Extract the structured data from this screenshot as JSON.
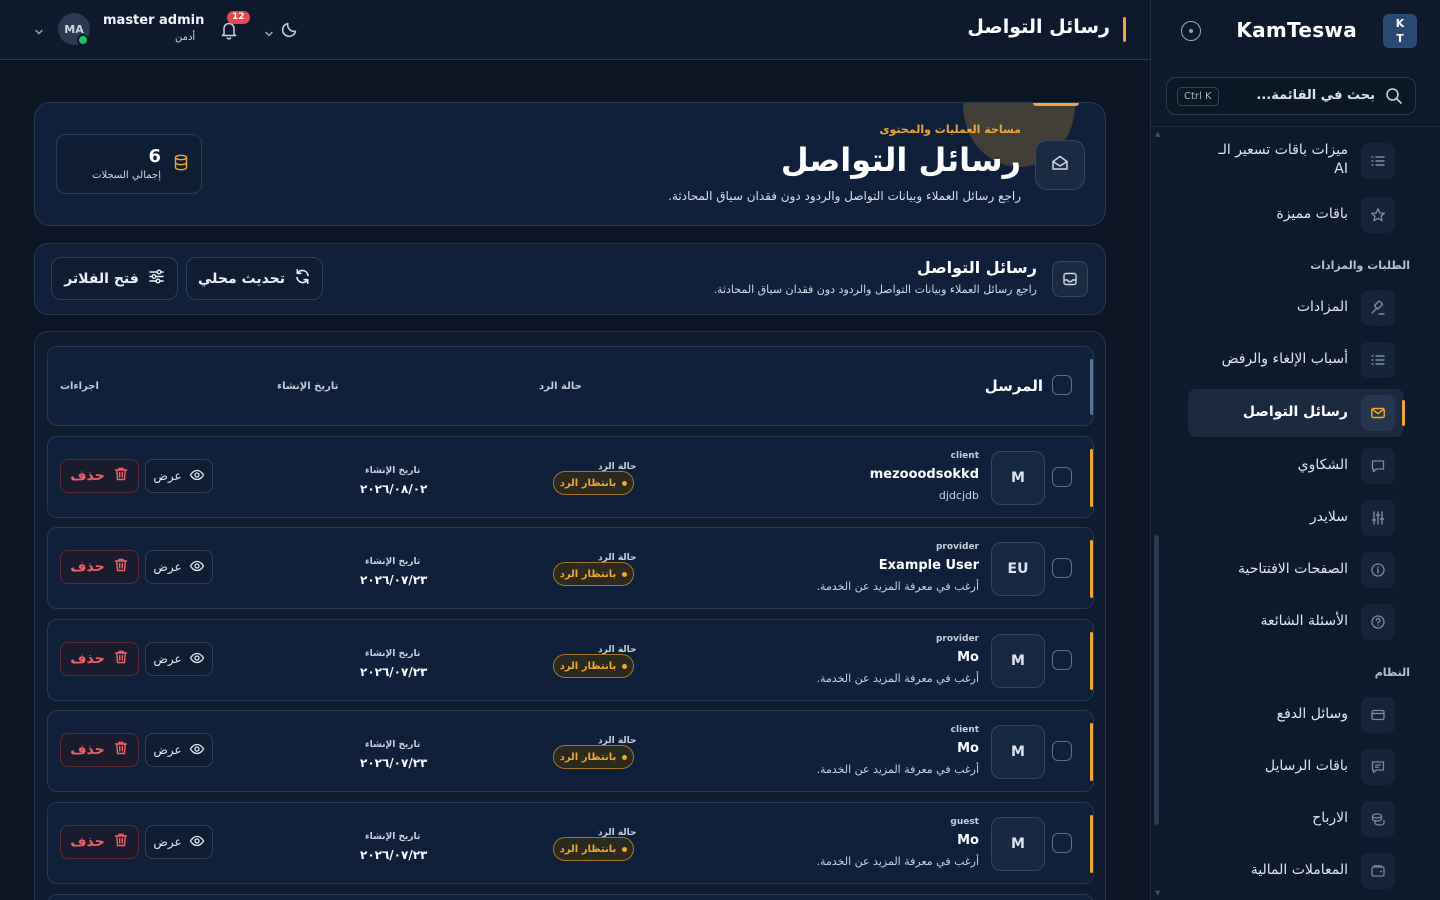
{
  "brand": {
    "name": "KamTeswa",
    "logo_line1": "K",
    "logo_line2": "T"
  },
  "sidebar": {
    "search_placeholder": "بحث في القائمة...",
    "search_shortcut": "Ctrl K",
    "items_top": [
      {
        "label": "ميزات باقات تسعير الـ AI",
        "icon": "list-icon"
      },
      {
        "label": "باقات مميزة",
        "icon": "star-icon"
      }
    ],
    "section_orders": "الطلبات والمزادات",
    "items_orders": [
      {
        "label": "المزادات",
        "icon": "gavel-icon"
      },
      {
        "label": "أسباب الإلغاء والرفض",
        "icon": "list-icon"
      },
      {
        "label": "رسائل التواصل",
        "icon": "mail-icon",
        "active": true
      },
      {
        "label": "الشكاوي",
        "icon": "chat-icon"
      },
      {
        "label": "سلايدر",
        "icon": "sliders-icon"
      },
      {
        "label": "الصفحات الافتتاحية",
        "icon": "info-icon"
      },
      {
        "label": "الأسئلة الشائعة",
        "icon": "help-icon"
      }
    ],
    "section_system": "النظام",
    "items_system": [
      {
        "label": "وسائل الدفع",
        "icon": "card-icon"
      },
      {
        "label": "باقات الرسايل",
        "icon": "message-icon"
      },
      {
        "label": "الارباح",
        "icon": "coins-icon"
      },
      {
        "label": "المعاملات المالية",
        "icon": "wallet-icon"
      }
    ]
  },
  "topbar": {
    "title": "رسائل التواصل",
    "user_name": "master admin",
    "user_role": "أدمن",
    "user_initials": "MA",
    "notifications_count": "12"
  },
  "hero": {
    "eyebrow": "مساحة العمليات والمحتوى",
    "title": "رسائل التواصل",
    "description": "راجع رسائل العملاء وبيانات التواصل والردود دون فقدان سياق المحادثة.",
    "stat_value": "6",
    "stat_label": "إجمالي السجلات"
  },
  "section": {
    "title": "رسائل التواصل",
    "description": "راجع رسائل العملاء وبيانات التواصل والردود دون فقدان سياق المحادثة.",
    "refresh_label": "تحديث محلي",
    "filters_label": "فتح الفلاتر"
  },
  "table": {
    "headers": {
      "sender": "المرسل",
      "status": "حالة الرد",
      "created": "تاريخ الإنشاء",
      "actions": "اجراءات"
    },
    "status_label": "حالة الرد",
    "created_label": "تاريخ الإنشاء",
    "view_label": "عرض",
    "delete_label": "حذف",
    "rows": [
      {
        "initials": "M",
        "role": "client",
        "name": "mezooodsokkd",
        "message": "djdcjdb",
        "status": "بانتظار الرد",
        "created": "٢٠٢٦/٠٨/٠٢"
      },
      {
        "initials": "EU",
        "role": "provider",
        "name": "Example User",
        "message": "أرغب في معرفة المزيد عن الخدمة.",
        "status": "بانتظار الرد",
        "created": "٢٠٢٦/٠٧/٢٣"
      },
      {
        "initials": "M",
        "role": "provider",
        "name": "Mo",
        "message": "أرغب في معرفة المزيد عن الخدمة.",
        "status": "بانتظار الرد",
        "created": "٢٠٢٦/٠٧/٢٣"
      },
      {
        "initials": "M",
        "role": "client",
        "name": "Mo",
        "message": "أرغب في معرفة المزيد عن الخدمة.",
        "status": "بانتظار الرد",
        "created": "٢٠٢٦/٠٧/٢٣"
      },
      {
        "initials": "M",
        "role": "guest",
        "name": "Mo",
        "message": "أرغب في معرفة المزيد عن الخدمة.",
        "status": "بانتظار الرد",
        "created": "٢٠٢٦/٠٧/٢٣"
      }
    ]
  },
  "colors": {
    "accent": "#f0a733",
    "background": "#0b1524",
    "panel": "#11203a",
    "danger": "#f0616a",
    "online": "#1fc16b"
  }
}
